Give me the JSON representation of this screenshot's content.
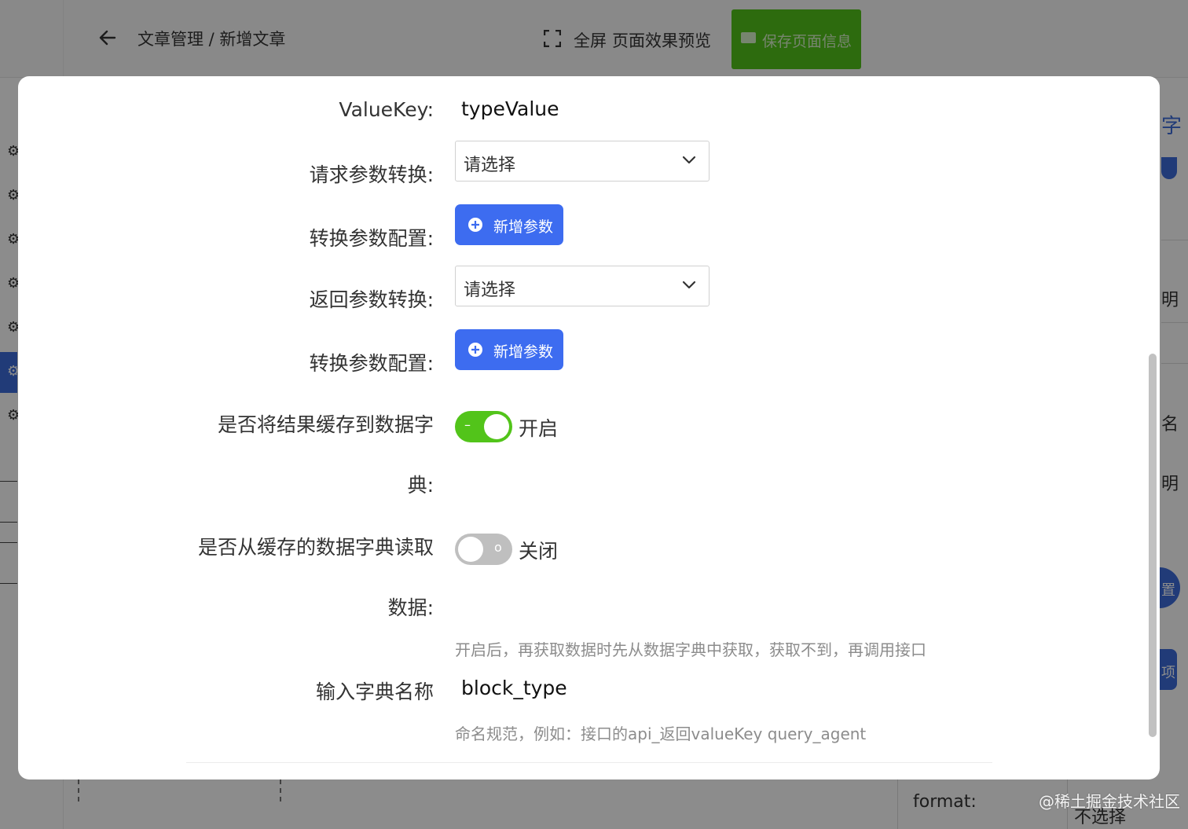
{
  "background": {
    "breadcrumb": "文章管理 / 新增文章",
    "fullscreen_label": "全屏",
    "preview_label": "页面效果预览",
    "save_label": "保存页面信息",
    "format_label": "format:",
    "format_value": "不选择",
    "right_fragments": [
      "字",
      "明",
      "名",
      "明",
      "置",
      "项"
    ],
    "watermark": "@稀土掘金技术社区"
  },
  "form": {
    "value_key": {
      "label": "ValueKey:",
      "value": "typeValue"
    },
    "request_transform": {
      "label": "请求参数转换:",
      "placeholder": "请选择"
    },
    "request_params": {
      "label": "转换参数配置:",
      "button": "新增参数"
    },
    "response_transform": {
      "label": "返回参数转换:",
      "placeholder": "请选择"
    },
    "response_params": {
      "label": "转换参数配置:",
      "button": "新增参数"
    },
    "cache_to_dict": {
      "label_line1": "是否将结果缓存到数据字",
      "label_line2": "典:",
      "on": true,
      "inner": "–",
      "state": "开启"
    },
    "read_from_dict": {
      "label_line1": "是否从缓存的数据字典读取",
      "label_line2": "数据:",
      "on": false,
      "inner": "o",
      "state": "关闭",
      "hint": "开启后，再获取数据时先从数据字典中获取，获取不到，再调用接口"
    },
    "dict_name": {
      "label": "输入字典名称",
      "value": "block_type",
      "hint": "命名规范，例如：接口的api_返回valueKey query_agent"
    }
  },
  "colors": {
    "primary": "#3d6cf0",
    "switch_on": "#52c41a",
    "switch_off": "#bfbfbf",
    "save_green": "#52c41a"
  },
  "icons": {
    "back": "arrow-left-icon",
    "fullscreen": "expand-icon",
    "save": "folder-icon",
    "settings": "gear-icon",
    "add": "plus-circle-icon",
    "dropdown": "chevron-down-icon"
  }
}
